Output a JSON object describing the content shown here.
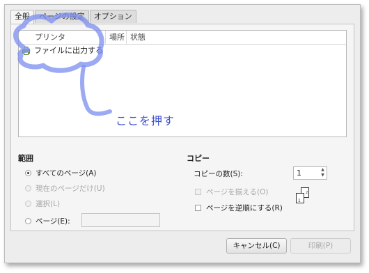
{
  "tabs": [
    {
      "label": "全般",
      "active": true
    },
    {
      "label": "ページの設定",
      "active": false
    },
    {
      "label": "オプション",
      "active": false
    }
  ],
  "printer_list": {
    "columns": [
      "プリンタ",
      "場所",
      "状態"
    ],
    "rows": [
      {
        "name": "ファイルに出力する",
        "icon": "printer-file-icon"
      }
    ]
  },
  "range": {
    "title": "範囲",
    "options": [
      {
        "label": "すべてのページ(A)",
        "selected": true,
        "enabled": true
      },
      {
        "label": "現在のページだけ(U)",
        "selected": false,
        "enabled": false
      },
      {
        "label": "選択(L)",
        "selected": false,
        "enabled": false
      },
      {
        "label": "ページ(E):",
        "selected": false,
        "enabled": true
      }
    ],
    "pages_input_value": ""
  },
  "copies": {
    "title": "コピー",
    "count_label": "コピーの数(S):",
    "count_value": "1",
    "collate_label": "ページを揃える(O)",
    "collate_checked": false,
    "collate_enabled": false,
    "reverse_label": "ページを逆順にする(R)",
    "reverse_checked": false,
    "reverse_enabled": true,
    "collate_icon_numbers": [
      "1",
      "2"
    ]
  },
  "buttons": {
    "cancel": "キャンセル(C)",
    "print": "印刷(P)",
    "print_enabled": false
  },
  "annotation": {
    "text": "ここを押す",
    "color": "#3b4fd0"
  }
}
